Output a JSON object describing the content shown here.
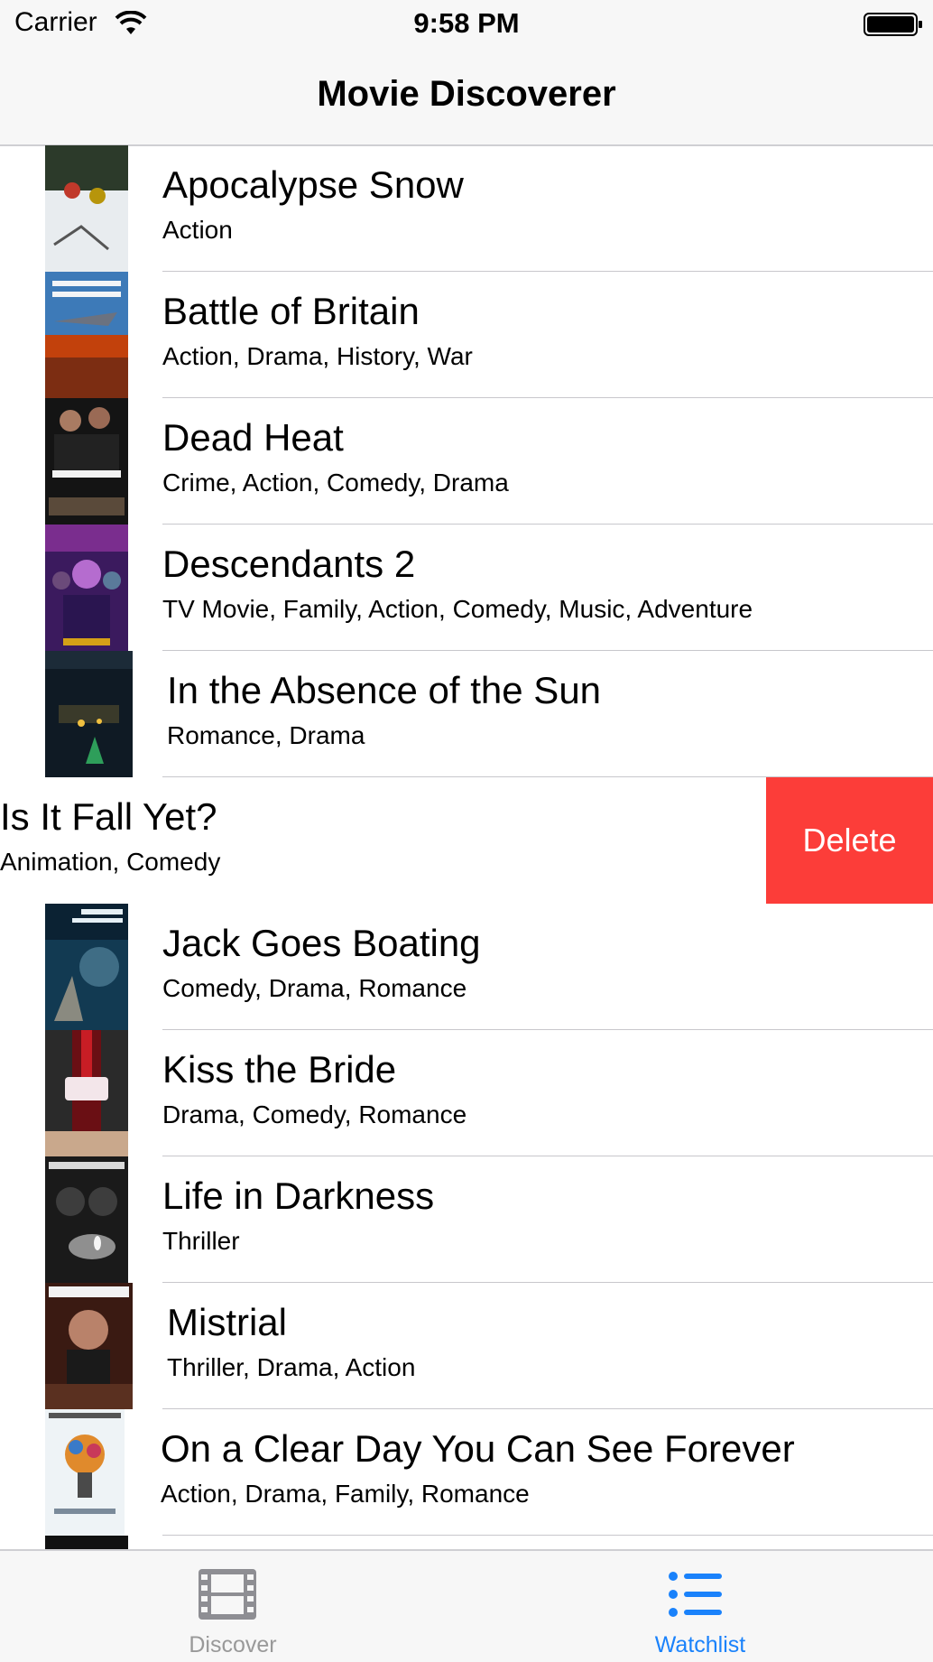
{
  "status_bar": {
    "carrier": "Carrier",
    "time": "9:58 PM"
  },
  "nav": {
    "title": "Movie Discoverer"
  },
  "movies": [
    {
      "title": "Apocalypse Snow",
      "genres": "Action"
    },
    {
      "title": "Battle of Britain",
      "genres": "Action, Drama, History, War"
    },
    {
      "title": "Dead Heat",
      "genres": "Crime, Action, Comedy, Drama"
    },
    {
      "title": "Descendants 2",
      "genres": "TV Movie, Family, Action, Comedy, Music, Adventure"
    },
    {
      "title": "In the Absence of the Sun",
      "genres": "Romance, Drama"
    },
    {
      "title": "Is It Fall Yet?",
      "genres": "Animation, Comedy"
    },
    {
      "title": "Jack Goes Boating",
      "genres": "Comedy, Drama, Romance"
    },
    {
      "title": "Kiss the Bride",
      "genres": "Drama, Comedy, Romance"
    },
    {
      "title": "Life in Darkness",
      "genres": "Thriller"
    },
    {
      "title": "Mistrial",
      "genres": "Thriller, Drama, Action"
    },
    {
      "title": "On a Clear Day You Can See Forever",
      "genres": "Action, Drama, Family, Romance"
    }
  ],
  "swipe_action": {
    "label": "Delete",
    "color": "#fc3d39"
  },
  "tabs": [
    {
      "label": "Discover",
      "icon": "film-icon",
      "selected": false
    },
    {
      "label": "Watchlist",
      "icon": "list-icon",
      "selected": true
    }
  ],
  "colors": {
    "accent": "#1a82fb",
    "inactive": "#999999",
    "separator": "#c8c7cc",
    "bar_background": "#f7f7f7"
  }
}
